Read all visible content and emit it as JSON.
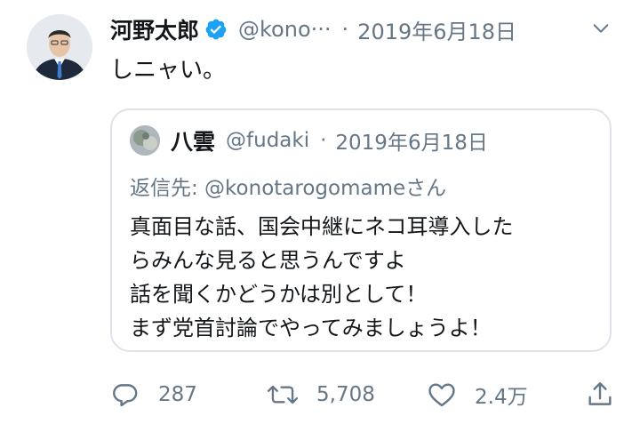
{
  "tweet": {
    "author_name": "河野太郎",
    "handle": "@kono···",
    "separator": "·",
    "date": "2019年6月18日",
    "text": "しニャい。"
  },
  "quoted_tweet": {
    "author_name": "八雲",
    "handle": "@fudaki",
    "separator": "·",
    "date": "2019年6月18日",
    "reply_to": "返信先: @konotarogomameさん",
    "lines": [
      "真面目な話、国会中継にネコ耳導入した",
      "らみんな見ると思うんですよ",
      "話を聞くかどうかは別として！",
      "まず党首討論でやってみましょうよ！"
    ]
  },
  "actions": {
    "reply_count": "287",
    "retweet_count": "5,708",
    "like_count": "2.4万"
  },
  "colors": {
    "verified": "#1da1f2",
    "secondary_text": "#657786",
    "border": "#dde3e8"
  },
  "icons": [
    "verified-badge-icon",
    "chevron-down-icon",
    "reply-icon",
    "retweet-icon",
    "like-icon",
    "share-icon"
  ]
}
